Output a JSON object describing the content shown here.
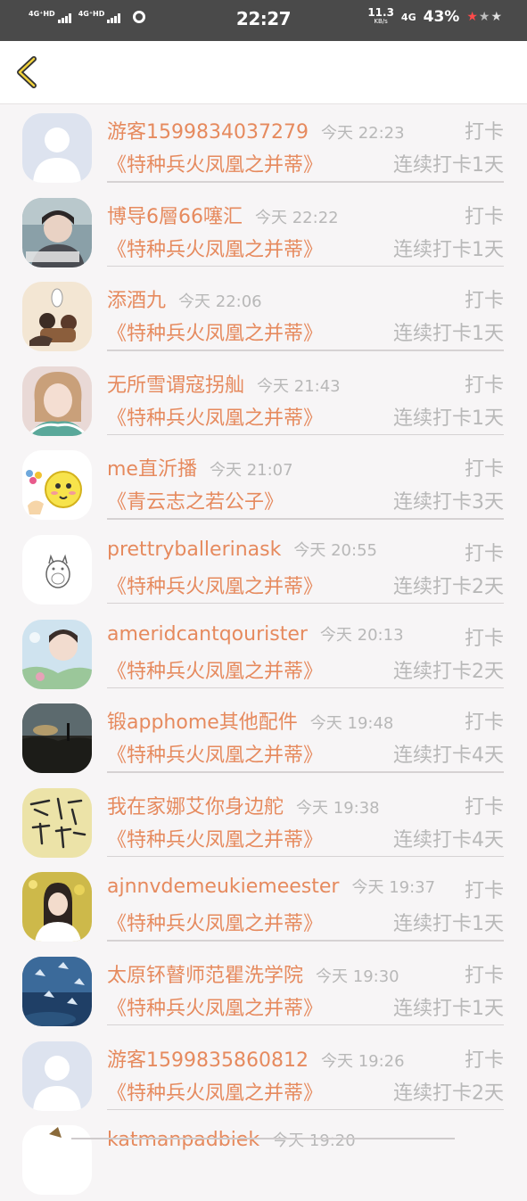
{
  "status_bar": {
    "sim1": "4G⁺HD",
    "sim2": "4G⁺HD",
    "time": "22:27",
    "speed_value": "11.3",
    "speed_unit": "KB/s",
    "network": "4G",
    "battery": "43%"
  },
  "header": {
    "back_icon": "chevron-left-icon"
  },
  "checkins": [
    {
      "user": "游客1599834037279",
      "time": "今天 22:23",
      "action": "打卡",
      "book": "《特种兵火凤凰之并蒂》",
      "streak": "连续打卡1天",
      "avatar": "default-avatar"
    },
    {
      "user": "博导6層66噻汇",
      "time": "今天 22:22",
      "action": "打卡",
      "book": "《特种兵火凤凰之并蒂》",
      "streak": "连续打卡1天",
      "avatar": "photo-avatar"
    },
    {
      "user": "添酒九",
      "time": "今天 22:06",
      "action": "打卡",
      "book": "《特种兵火凤凰之并蒂》",
      "streak": "连续打卡1天",
      "avatar": "cartoon-avatar"
    },
    {
      "user": "无所雪谓寇拐舢",
      "time": "今天 21:43",
      "action": "打卡",
      "book": "《特种兵火凤凰之并蒂》",
      "streak": "连续打卡1天",
      "avatar": "photo-avatar"
    },
    {
      "user": "me直沂播",
      "time": "今天 21:07",
      "action": "打卡",
      "book": "《青云志之若公子》",
      "streak": "连续打卡3天",
      "avatar": "emoji-avatar"
    },
    {
      "user": "prettryballerinask",
      "time": "今天 20:55",
      "action": "打卡",
      "book": "《特种兵火凤凰之并蒂》",
      "streak": "连续打卡2天",
      "avatar": "totoro-avatar"
    },
    {
      "user": "ameridcantqourister",
      "time": "今天 20:13",
      "action": "打卡",
      "book": "《特种兵火凤凰之并蒂》",
      "streak": "连续打卡2天",
      "avatar": "photo-avatar"
    },
    {
      "user": "锻apphome其他配件",
      "time": "今天 19:48",
      "action": "打卡",
      "book": "《特种兵火凤凰之并蒂》",
      "streak": "连续打卡4天",
      "avatar": "sunset-avatar"
    },
    {
      "user": "我在家娜艾你身边舵",
      "time": "今天 19:38",
      "action": "打卡",
      "book": "《特种兵火凤凰之并蒂》",
      "streak": "连续打卡4天",
      "avatar": "calligraphy-avatar"
    },
    {
      "user": "ajnnvdemeukiemeester",
      "time": "今天 19:37",
      "action": "打卡",
      "book": "《特种兵火凤凰之并蒂》",
      "streak": "连续打卡1天",
      "avatar": "photo-avatar"
    },
    {
      "user": "太原钚瞽师范瞿洗学院",
      "time": "今天 19:30",
      "action": "打卡",
      "book": "《特种兵火凤凰之并蒂》",
      "streak": "连续打卡1天",
      "avatar": "blue-avatar"
    },
    {
      "user": "游客1599835860812",
      "time": "今天 19:26",
      "action": "打卡",
      "book": "《特种兵火凤凰之并蒂》",
      "streak": "连续打卡2天",
      "avatar": "default-avatar"
    }
  ],
  "partial_row": {
    "user": "katmanpadbiek",
    "time": "今天 19:20"
  },
  "colors": {
    "accent": "#e68a5e",
    "muted": "#b8b8b8",
    "status_bar": "#4a4a4a"
  }
}
